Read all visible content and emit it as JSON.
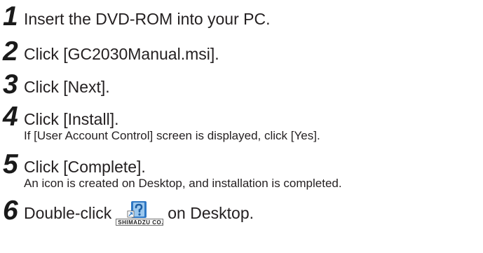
{
  "steps": [
    {
      "number": "1",
      "text": "Insert the DVD-ROM into your PC."
    },
    {
      "number": "2",
      "text": "Click [GC2030Manual.msi]."
    },
    {
      "number": "3",
      "text": "Click [Next]."
    },
    {
      "number": "4",
      "text": "Click [Install].",
      "note": "If [User Account Control] screen is displayed, click [Yes]."
    },
    {
      "number": "5",
      "text": "Click [Complete].",
      "note": "An icon is created on Desktop, and installation is completed."
    },
    {
      "number": "6",
      "text_before": "Double-click",
      "text_after": "on Desktop.",
      "icon_caption": "SHIMADZU CO..."
    }
  ],
  "colors": {
    "text": "#231f20",
    "icon_blue": "#2f78c4",
    "icon_light": "#9cc8ee"
  },
  "icons": {
    "desktop_shortcut": "help-document-shortcut-icon"
  }
}
